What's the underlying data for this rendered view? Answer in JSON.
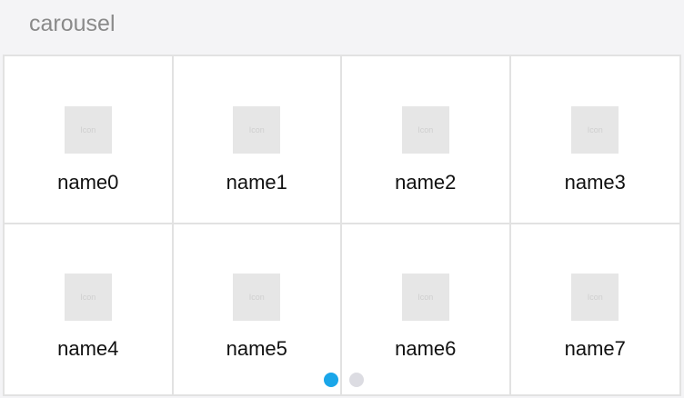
{
  "header": {
    "title": "carousel"
  },
  "carousel": {
    "items": [
      {
        "icon_text": "Icon",
        "label": "name0"
      },
      {
        "icon_text": "Icon",
        "label": "name1"
      },
      {
        "icon_text": "Icon",
        "label": "name2"
      },
      {
        "icon_text": "Icon",
        "label": "name3"
      },
      {
        "icon_text": "Icon",
        "label": "name4"
      },
      {
        "icon_text": "Icon",
        "label": "name5"
      },
      {
        "icon_text": "Icon",
        "label": "name6"
      },
      {
        "icon_text": "Icon",
        "label": "name7"
      }
    ],
    "page_count": 2,
    "active_page": 1
  },
  "colors": {
    "active_dot": "#1aa6e9",
    "inactive_dot": "#dcdce2",
    "icon_placeholder": "#e6e6e6",
    "title_text": "#8a8a8a"
  }
}
